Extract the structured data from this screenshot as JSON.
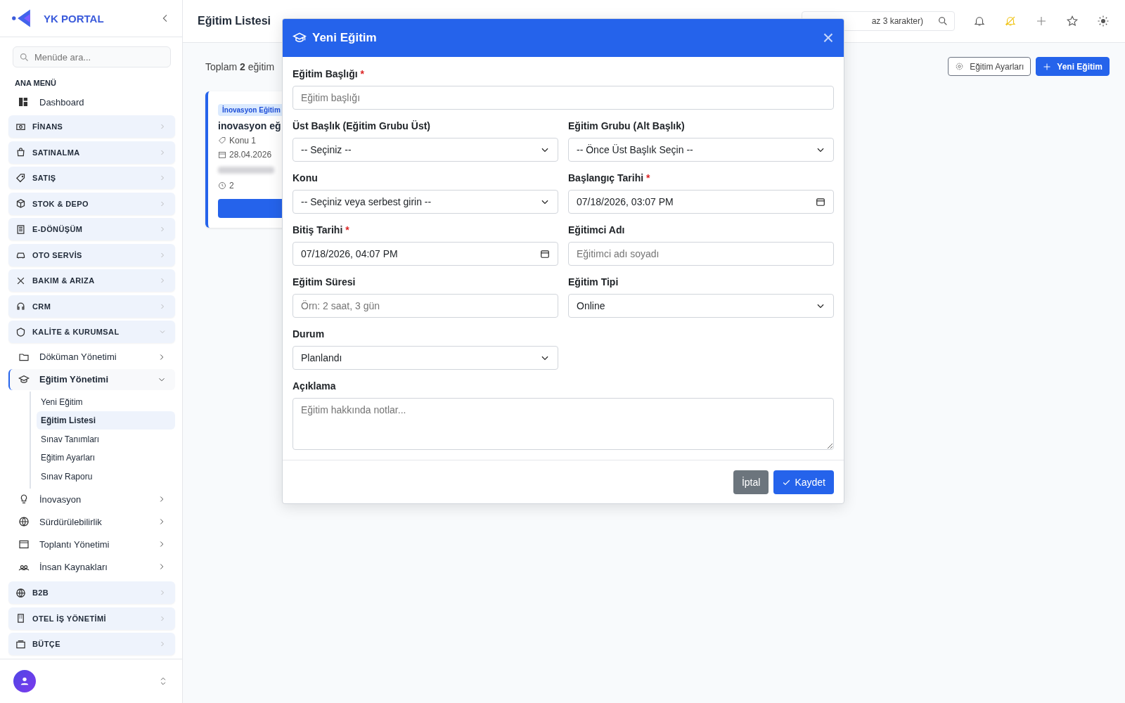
{
  "brand": {
    "name": "YK PORTAL"
  },
  "sidebar": {
    "search": {
      "placeholder": "Menüde ara..."
    },
    "section_title": "ANA MENÜ",
    "items": [
      {
        "label": "Dashboard",
        "kind": "link"
      },
      {
        "label": "FİNANS",
        "kind": "group",
        "expanded": false
      },
      {
        "label": "SATINALMA",
        "kind": "group",
        "expanded": false
      },
      {
        "label": "SATIŞ",
        "kind": "group",
        "expanded": false
      },
      {
        "label": "STOK & DEPO",
        "kind": "group",
        "expanded": false
      },
      {
        "label": "E-DÖNÜŞÜM",
        "kind": "group",
        "expanded": false
      },
      {
        "label": "OTO SERVİS",
        "kind": "group",
        "expanded": false
      },
      {
        "label": "BAKIM & ARIZA",
        "kind": "group",
        "expanded": false
      },
      {
        "label": "CRM",
        "kind": "group",
        "expanded": false
      },
      {
        "label": "KALİTE & KURUMSAL",
        "kind": "group",
        "expanded": true,
        "children": [
          {
            "label": "Döküman Yönetimi",
            "expanded": false
          },
          {
            "label": "Eğitim Yönetimi",
            "expanded": true,
            "children": [
              {
                "label": "Yeni Eğitim",
                "selected": false
              },
              {
                "label": "Eğitim Listesi",
                "selected": true
              },
              {
                "label": "Sınav Tanımları",
                "selected": false
              },
              {
                "label": "Eğitim Ayarları",
                "selected": false
              },
              {
                "label": "Sınav Raporu",
                "selected": false
              }
            ]
          },
          {
            "label": "İnovasyon",
            "expanded": false
          },
          {
            "label": "Sürdürülebilirlik",
            "expanded": false
          },
          {
            "label": "Toplantı Yönetimi",
            "expanded": false
          },
          {
            "label": "İnsan Kaynakları",
            "expanded": false
          }
        ]
      },
      {
        "label": "B2B",
        "kind": "group",
        "expanded": false
      },
      {
        "label": "OTEL İŞ YÖNETİMİ",
        "kind": "group",
        "expanded": false
      },
      {
        "label": "BÜTÇE",
        "kind": "group",
        "expanded": false
      }
    ]
  },
  "header": {
    "title": "Eğitim Listesi",
    "search": {
      "placeholder": "az 3 karakter)"
    }
  },
  "page": {
    "total_prefix": "Toplam",
    "total_count": "2",
    "total_suffix": "eğitim",
    "buttons": [
      {
        "label": "Eğitim Ayarları",
        "kind": "secondary"
      },
      {
        "label": "Yeni Eğitim",
        "kind": "primary"
      }
    ],
    "card": {
      "tag": "İnovasyon Eğitim",
      "title": "inovasyon eğ",
      "topic": "Konu 1",
      "date": "28.04.2026",
      "count": "2"
    }
  },
  "modal": {
    "title": "Yeni Eğitim",
    "close": "×",
    "title_field": {
      "label": "Eğitim Başlığı",
      "mark": "*",
      "placeholder": "Eğitim başlığı"
    },
    "fields": [
      {
        "label": "Üst Başlık (Eğitim Grubu Üst)",
        "kind": "select",
        "value": "-- Seçiniz --"
      },
      {
        "label": "Eğitim Grubu (Alt Başlık)",
        "kind": "select",
        "value": "-- Önce Üst Başlık Seçin --"
      },
      {
        "label": "Konu",
        "kind": "select",
        "value": "-- Seçiniz veya serbest girin --"
      },
      {
        "label": "Başlangıç Tarihi",
        "mark": "*",
        "kind": "datetime",
        "value": "07/18/2026, 03:07  PM"
      },
      {
        "label": "Bitiş Tarihi",
        "mark": "*",
        "kind": "datetime",
        "value": "07/18/2026, 04:07  PM"
      },
      {
        "label": "Eğitimci Adı",
        "kind": "text",
        "placeholder": "Eğitimci adı soyadı"
      },
      {
        "label": "Eğitim Süresi",
        "kind": "text",
        "placeholder": "Örn: 2 saat, 3 gün"
      },
      {
        "label": "Eğitim Tipi",
        "kind": "select",
        "value": "Online"
      },
      {
        "label": "Durum",
        "kind": "select",
        "value": "Planlandı"
      }
    ],
    "notes_field": {
      "label": "Açıklama",
      "placeholder": "Eğitim hakkında notlar..."
    },
    "buttons": [
      {
        "label": "İptal",
        "kind": "secondary"
      },
      {
        "label": "Kaydet",
        "kind": "primary"
      }
    ]
  }
}
